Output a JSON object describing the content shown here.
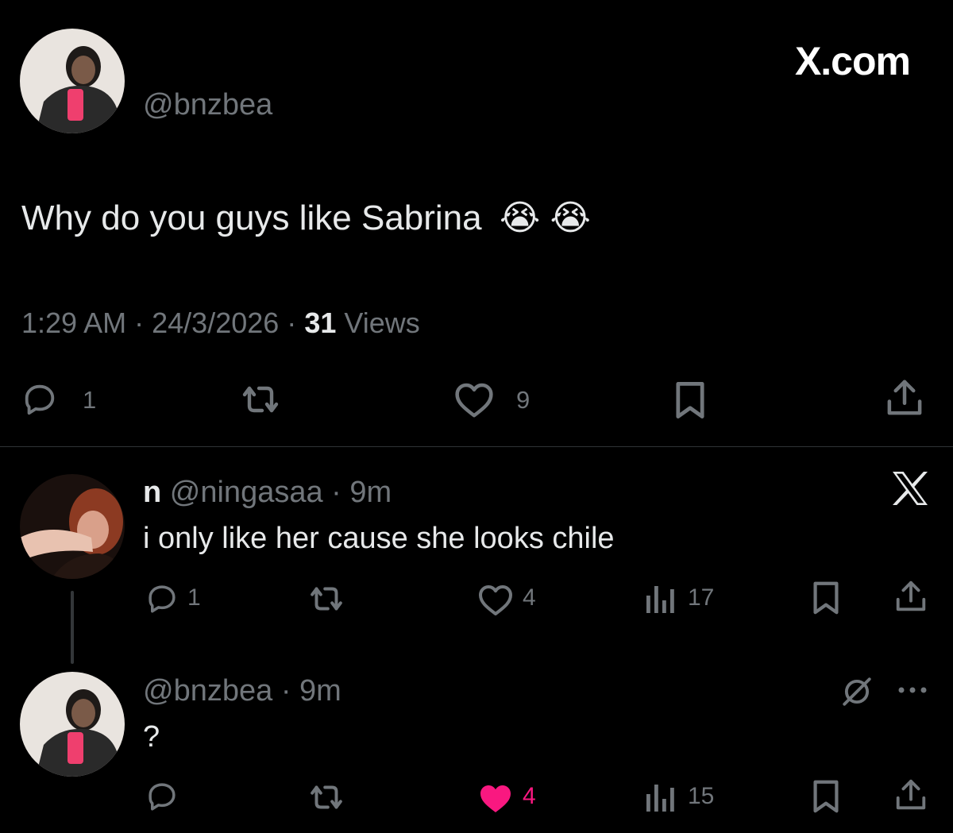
{
  "brand": {
    "site": "X.com"
  },
  "main_post": {
    "handle": "@bnzbea",
    "text": "Why do you guys like Sabrina",
    "emoji": "😭 😭",
    "time": "1:29 AM",
    "sep1": "·",
    "date": "24/3/2026",
    "sep2": "·",
    "views_count": "31",
    "views_label": "Views",
    "actions": {
      "replies": "1",
      "likes": "9"
    }
  },
  "reply_1": {
    "display_name": "n",
    "handle": "@ningasaa",
    "sep": "·",
    "age": "9m",
    "text": "i only like her cause she looks chile",
    "actions": {
      "replies": "1",
      "likes": "4",
      "views": "17"
    }
  },
  "reply_2": {
    "handle": "@bnzbea",
    "sep": "·",
    "age": "9m",
    "text": "?",
    "actions": {
      "likes": "4",
      "views": "15"
    }
  },
  "colors": {
    "background": "#000000",
    "text": "#e7e9ea",
    "muted": "#71767b",
    "like_active": "#f91880",
    "divider": "#2f3336"
  },
  "icons": [
    "reply-icon",
    "retweet-icon",
    "heart-icon",
    "bookmark-icon",
    "share-icon",
    "views-icon",
    "x-logo-icon",
    "grok-icon",
    "more-icon"
  ]
}
